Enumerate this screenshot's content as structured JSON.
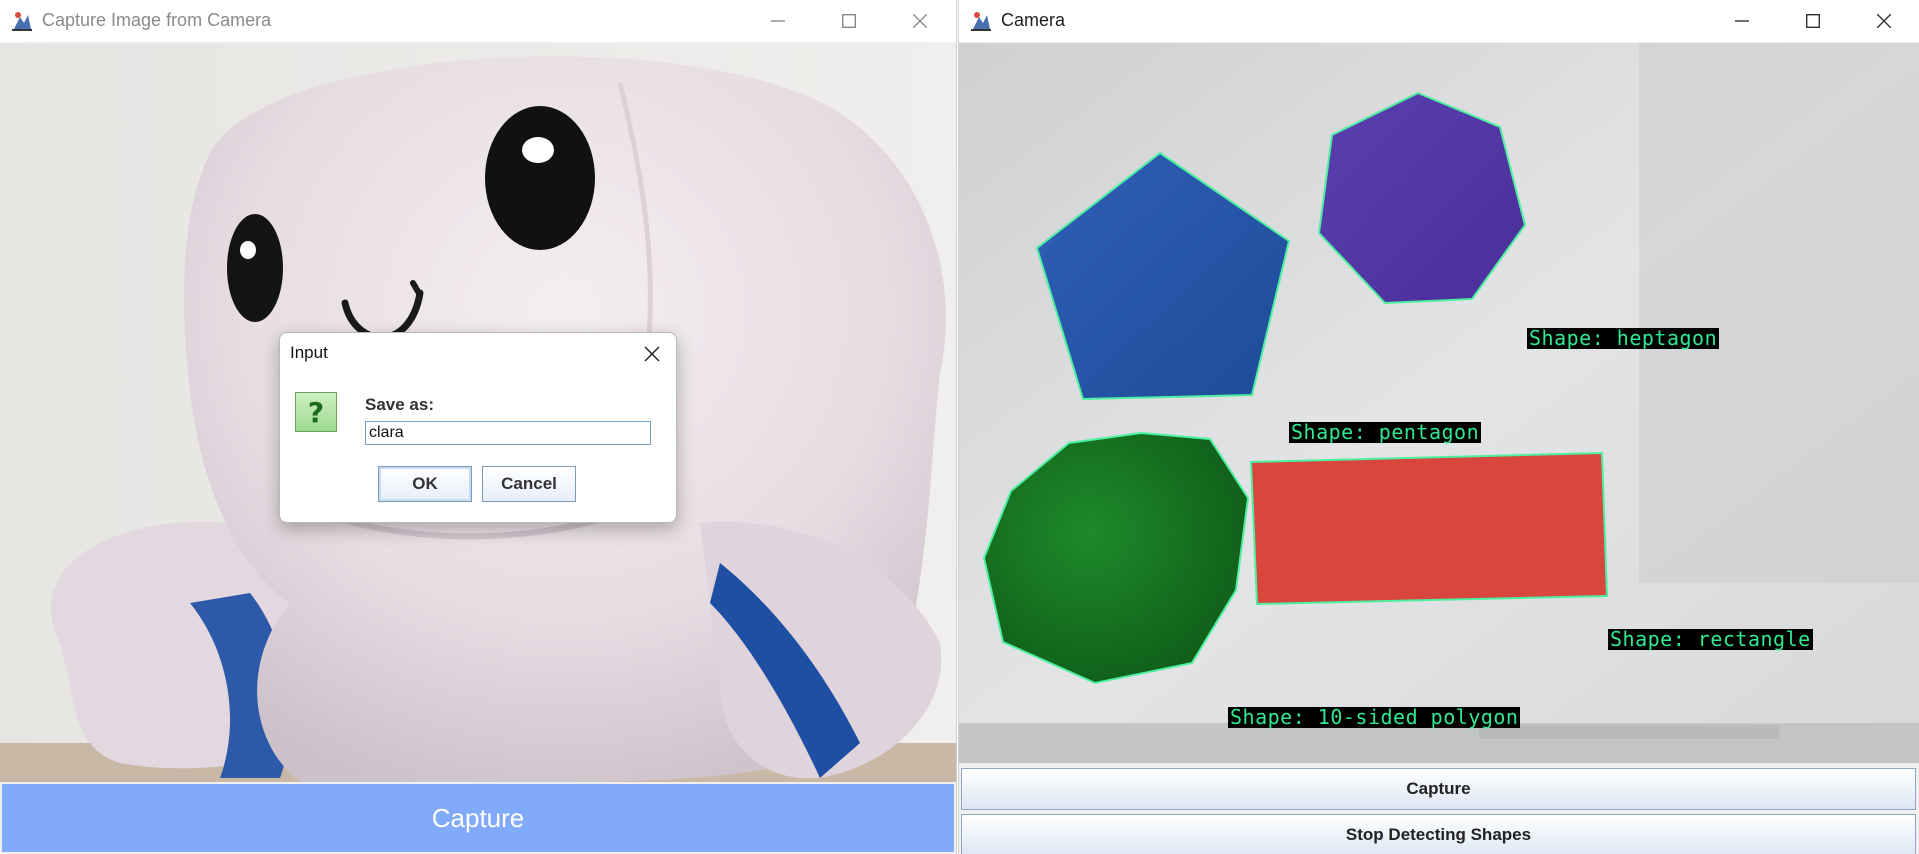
{
  "left_window": {
    "title": "Capture Image from Camera",
    "capture_button_label": "Capture"
  },
  "dialog": {
    "title": "Input",
    "icon_glyph": "?",
    "prompt_label": "Save as:",
    "input_value": "clara",
    "ok_label": "OK",
    "cancel_label": "Cancel"
  },
  "right_window": {
    "title": "Camera",
    "shape_labels": {
      "heptagon": "Shape: heptagon",
      "pentagon": "Shape: pentagon",
      "rectangle": "Shape: rectangle",
      "polygon10": "Shape: 10-sided polygon"
    },
    "capture_button_label": "Capture",
    "stop_button_label": "Stop Detecting Shapes"
  },
  "colors": {
    "capture_button_bg": "#82aafa",
    "label_text": "#30e890",
    "contour": "#4cf0a0"
  },
  "icons": [
    "java-app-icon",
    "minimize-icon",
    "maximize-icon",
    "close-icon",
    "question-icon"
  ]
}
